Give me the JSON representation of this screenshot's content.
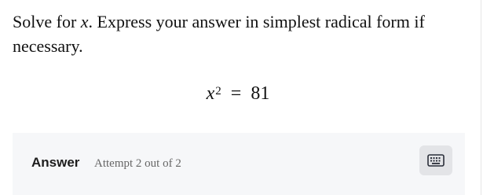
{
  "question": {
    "prompt_prefix": "Solve for ",
    "prompt_variable": "x",
    "prompt_suffix": ". Express your answer in simplest radical form if necessary.",
    "equation": {
      "base": "x",
      "exponent": "2",
      "operator": "=",
      "rhs": "81"
    }
  },
  "answer_panel": {
    "label": "Answer",
    "attempt_text": "Attempt 2 out of 2",
    "keyboard_icon": "keyboard-icon"
  }
}
